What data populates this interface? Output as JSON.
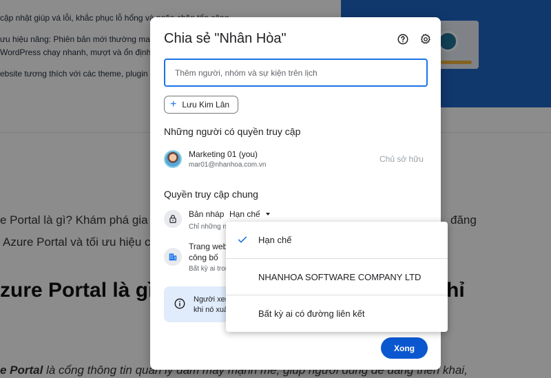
{
  "background": {
    "bullet_lines": [
      "cập nhật giúp vá lỗi, khắc phục lỗ hổng và ngăn chặn tấn công",
      "ưu hiệu năng: Phiên bản mới thường mang",
      "WordPress chạy nhanh, mượt và ổn định h",
      "ebsite tương thích với các theme, plugin v"
    ],
    "intro_lines": [
      "e Portal là gì? Khám phá gia",
      "Azure Portal và tối ưu hiệu c"
    ],
    "intro_right": "đăng",
    "heading_left": "zure Portal là gì",
    "heading_right": "hỉ",
    "bottom_prefix": "e Portal",
    "bottom_rest": " là cổng thông tin quản lý đám mây mạnh mẽ, giúp người dùng dễ dàng triển khai,"
  },
  "dialog": {
    "title": "Chia sẻ \"Nhân Hòa\"",
    "help_icon": "help-icon",
    "settings_icon": "gear-icon",
    "input_placeholder": "Thêm người, nhóm và sự kiện trên lịch",
    "chip_label": "Lưu Kim Lân",
    "people_section": "Những người có quyền truy cập",
    "person": {
      "name": "Marketing 01 (you)",
      "email": "mar01@nhanhoa.com.vn",
      "role": "Chủ sở hữu"
    },
    "general_section": "Quyền truy cập chung",
    "draft": {
      "label": "Bản nháp",
      "selected": "Hạn chế",
      "sub": "Chỉ những n"
    },
    "web": {
      "label_line1": "Trang web",
      "label_line2": "công bố",
      "sub": "Bất kỳ ai tron"
    },
    "notice": {
      "line1": "Người xem",
      "line2": "khi nó xuấ"
    },
    "done_label": "Xong"
  },
  "menu": {
    "items": [
      {
        "label": "Hạn chế",
        "selected": true
      },
      {
        "label": "NHANHOA SOFTWARE COMPANY LTD",
        "selected": false
      },
      {
        "label": "Bất kỳ ai có đường liên kết",
        "selected": false
      }
    ]
  },
  "colors": {
    "accent": "#1a73e8",
    "button": "#0b57d0",
    "notice_bg": "#e0ecfb"
  }
}
